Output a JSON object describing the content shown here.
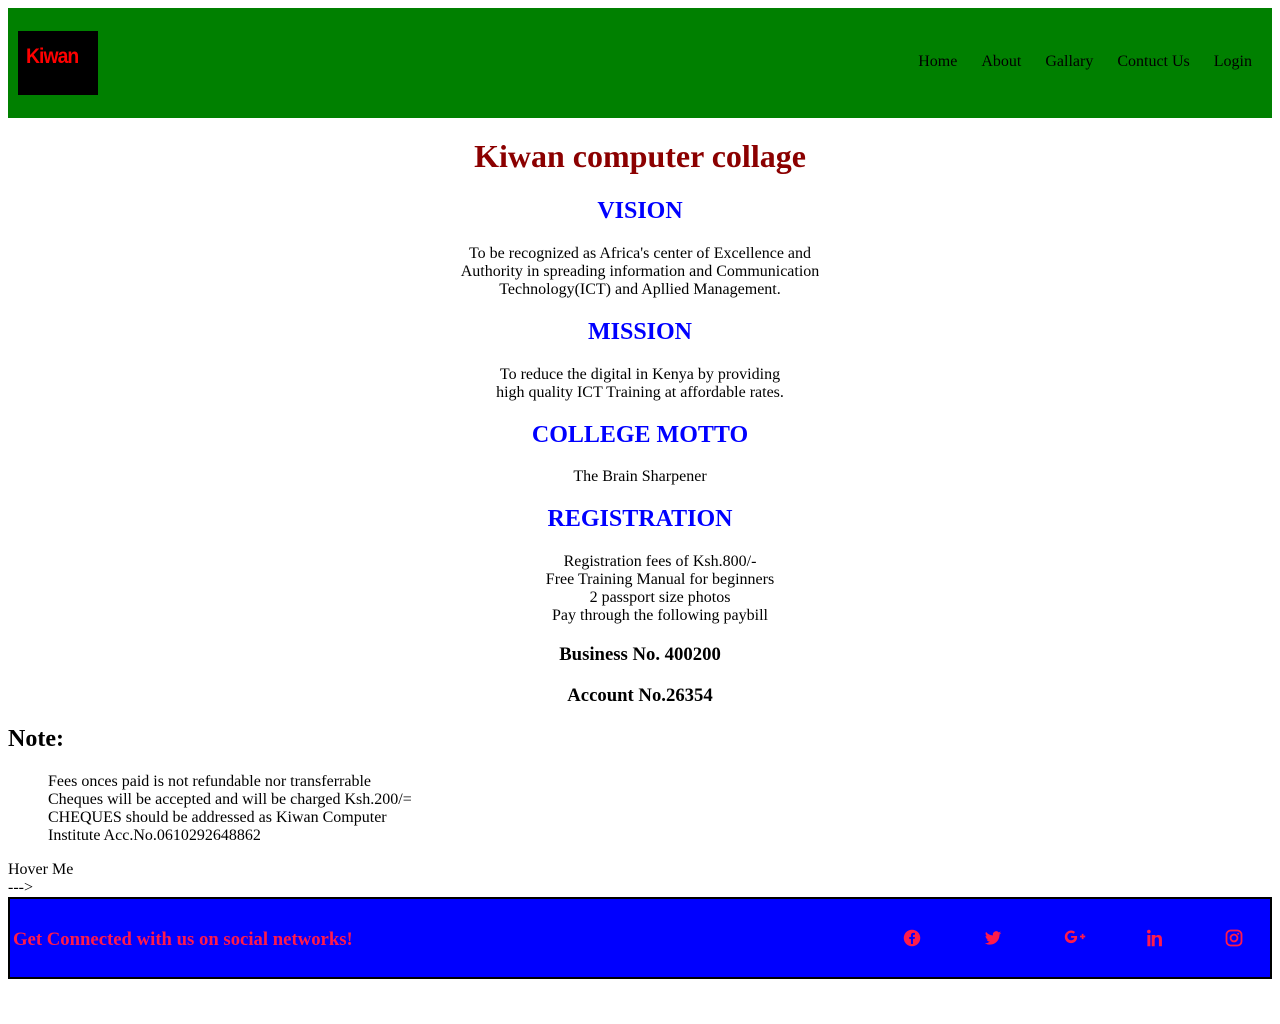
{
  "header": {
    "logo_text": "Kiwan",
    "nav": [
      "Home",
      "About",
      "Gallary",
      "Contuct Us",
      "Login"
    ]
  },
  "main": {
    "title": "Kiwan computer collage",
    "vision": {
      "heading": "VISION",
      "lines": [
        "To be recognized as Africa's center of Excellence and",
        "Authority in spreading information and Communication",
        "Technology(ICT) and Apllied Management."
      ]
    },
    "mission": {
      "heading": "MISSION",
      "lines": [
        "To reduce the digital in Kenya by providing",
        "high quality ICT Training at affordable rates."
      ]
    },
    "motto": {
      "heading": "COLLEGE MOTTO",
      "lines": [
        "The Brain Sharpener"
      ]
    },
    "registration": {
      "heading": "REGISTRATION",
      "lines": [
        "Registration fees of Ksh.800/-",
        "Free Training Manual for beginners",
        "2 passport size photos",
        "Pay through the following paybill"
      ],
      "business": "Business No. 400200",
      "account": "Account No.26354"
    }
  },
  "note": {
    "heading": "Note:",
    "lines": [
      "Fees onces paid is not refundable nor transferrable",
      "Cheques will be accepted and will be charged Ksh.200/=",
      "CHEQUES should be addressed as Kiwan Computer",
      "Institute Acc.No.0610292648862"
    ]
  },
  "hover": {
    "label": "Hover Me",
    "arrow": "--->"
  },
  "footer": {
    "text": "Get Connected with us on social networks!",
    "icons": [
      "facebook-icon",
      "twitter-icon",
      "google-plus-icon",
      "linkedin-icon",
      "instagram-icon"
    ],
    "icon_color": "#ff1a4b",
    "background": "#0000ff"
  },
  "colors": {
    "header_bg": "#008000",
    "title": "#8b0000",
    "section_heading": "#0000ff",
    "logo_text": "#ff0000"
  }
}
